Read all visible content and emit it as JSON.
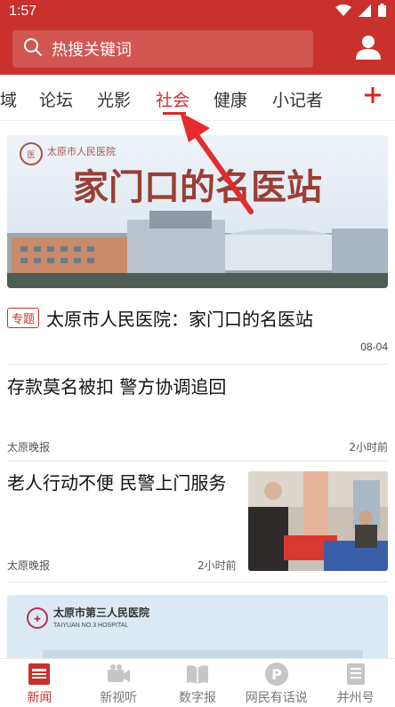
{
  "status": {
    "time": "1:57"
  },
  "search": {
    "placeholder": "热搜关键词"
  },
  "tabs": [
    {
      "label": "域"
    },
    {
      "label": "论坛"
    },
    {
      "label": "光影"
    },
    {
      "label": "社会",
      "active": true
    },
    {
      "label": "健康"
    },
    {
      "label": "小记者"
    }
  ],
  "feature": {
    "banner_text": "家门口的名医站",
    "hospital_logo_text": "太原市人民医院",
    "tag": "专题",
    "title": "太原市人民医院：家门口的名医站",
    "date": "08-04"
  },
  "articles": [
    {
      "title": "存款莫名被扣 警方协调追回",
      "source": "太原晚报",
      "time": "2小时前"
    },
    {
      "title": "老人行动不便 民警上门服务",
      "source": "太原晚报",
      "time": "2小时前"
    }
  ],
  "banner2": {
    "hospital_cn": "太原市第三人民医院",
    "hospital_en": "TAIYUAN NO.3 HOSPITAL"
  },
  "bottom_nav": [
    {
      "label": "新闻",
      "icon": "news-icon",
      "active": true
    },
    {
      "label": "新视听",
      "icon": "video-icon"
    },
    {
      "label": "数字报",
      "icon": "book-icon"
    },
    {
      "label": "网民有话说",
      "icon": "comment-icon"
    },
    {
      "label": "并州号",
      "icon": "account-icon"
    }
  ],
  "colors": {
    "brand": "#c8312c"
  }
}
